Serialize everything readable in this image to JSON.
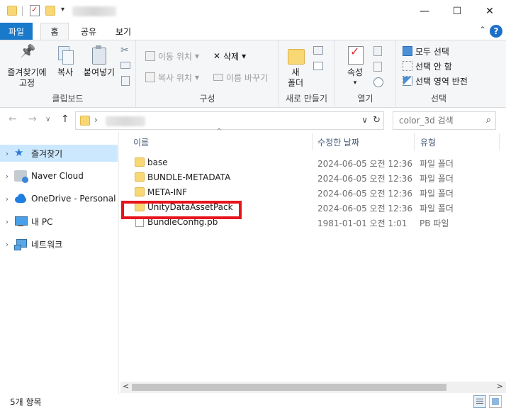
{
  "titlebar": {
    "min_label": "—",
    "max_label": "☐",
    "close_label": "✕"
  },
  "ribbon_tabs": {
    "file": "파일",
    "home": "홈",
    "share": "공유",
    "view": "보기",
    "collapse_glyph": "⌃",
    "help_glyph": "?"
  },
  "ribbon": {
    "clipboard": {
      "pin_label_line1": "즐겨찾기에",
      "pin_label_line2": "고정",
      "copy": "복사",
      "paste": "붙여넣기",
      "group": "클립보드"
    },
    "organize": {
      "move_to": "이동 위치",
      "copy_to": "복사 위치",
      "delete": "삭제",
      "rename": "이름 바꾸기",
      "group": "구성"
    },
    "new": {
      "new_folder_line1": "새",
      "new_folder_line2": "폴더",
      "group": "새로 만들기"
    },
    "open": {
      "properties": "속성",
      "group": "열기"
    },
    "select": {
      "select_all": "모두 선택",
      "select_none": "선택 안 함",
      "invert": "선택 영역 반전",
      "group": "선택"
    }
  },
  "address": {
    "back_glyph": "←",
    "forward_glyph": "→",
    "recent_glyph": "∨",
    "up_glyph": "↑",
    "chevron": "›",
    "dropdown_glyph": "∨",
    "refresh_glyph": "↻",
    "search_placeholder": "color_3d 검색",
    "search_glyph": "⌕"
  },
  "nav": {
    "items": [
      {
        "label": "즐겨찾기",
        "icon": "star-icon",
        "selected": true
      },
      {
        "label": "Naver Cloud",
        "icon": "naver-cloud-icon"
      },
      {
        "label": "OneDrive - Personal",
        "icon": "onedrive-icon"
      },
      {
        "label": "내 PC",
        "icon": "pc-icon"
      },
      {
        "label": "네트워크",
        "icon": "network-icon"
      }
    ]
  },
  "columns": {
    "name": "이름",
    "date": "수정한 날짜",
    "type": "유형",
    "sort_glyph": "^"
  },
  "files": [
    {
      "name": "base",
      "date": "2024-06-05 오전 12:36",
      "type": "파일 폴더",
      "kind": "folder"
    },
    {
      "name": "BUNDLE-METADATA",
      "date": "2024-06-05 오전 12:36",
      "type": "파일 폴더",
      "kind": "folder"
    },
    {
      "name": "META-INF",
      "date": "2024-06-05 오전 12:36",
      "type": "파일 폴더",
      "kind": "folder"
    },
    {
      "name": "UnityDataAssetPack",
      "date": "2024-06-05 오전 12:36",
      "type": "파일 폴더",
      "kind": "folder",
      "highlighted": true
    },
    {
      "name": "BundleConfig.pb",
      "date": "1981-01-01 오전 1:01",
      "type": "PB 파일",
      "kind": "file"
    }
  ],
  "highlight_color": "#e8141c",
  "accent_color": "#1979ca",
  "status": {
    "count": "5개 항목"
  },
  "scroll": {
    "left_glyph": "<",
    "right_glyph": ">"
  }
}
